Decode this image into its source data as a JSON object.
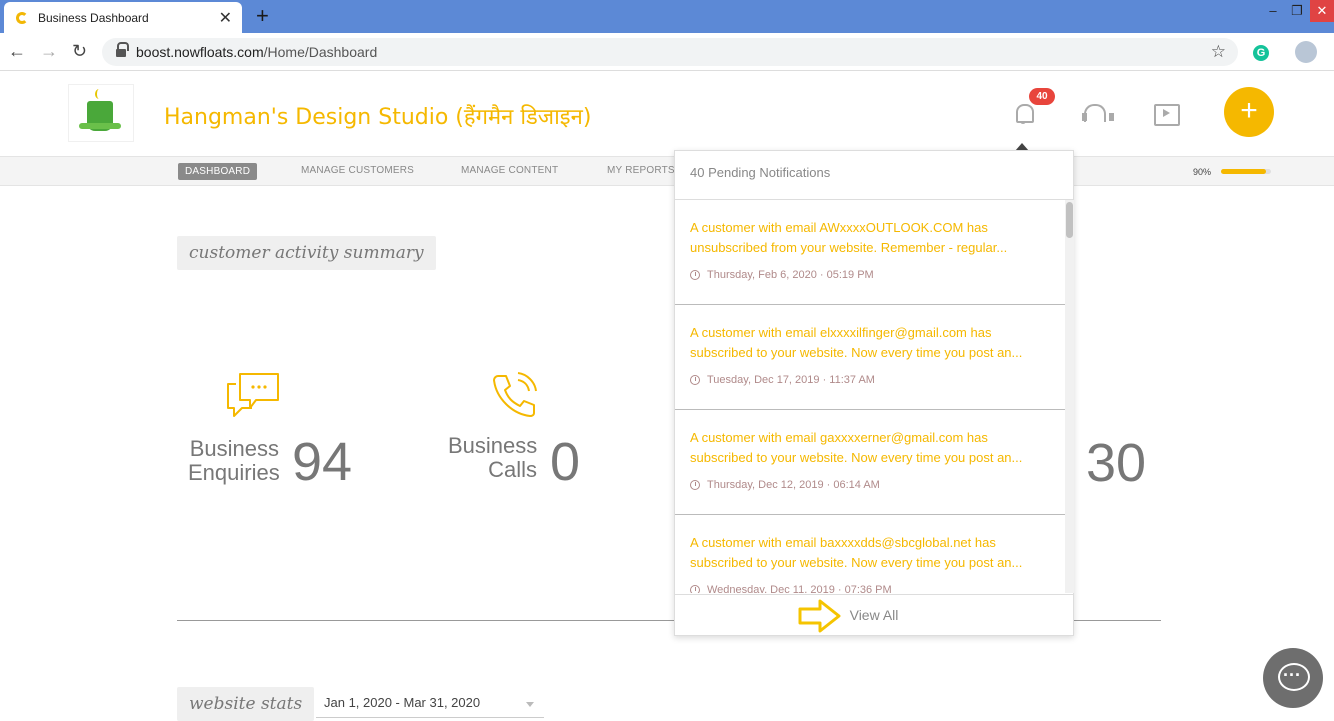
{
  "browser": {
    "tab_title": "Business Dashboard",
    "url_domain": "boost.nowfloats.com",
    "url_path": "/Home/Dashboard"
  },
  "header": {
    "business_name": "Hangman's Design Studio (हैंगमैन डिजाइन)",
    "notification_count": "40",
    "add_label": "+"
  },
  "subnav": {
    "items": [
      "DASHBOARD",
      "MANAGE CUSTOMERS",
      "MANAGE CONTENT",
      "MY REPORTS"
    ],
    "active": "DASHBOARD",
    "profile_completion_label": "90%",
    "profile_completion": 0.9
  },
  "activity": {
    "title": "customer activity summary",
    "stats": [
      {
        "label_line1": "Business",
        "label_line2": "Enquiries",
        "value": "94",
        "icon": "chat-bubbles-icon"
      },
      {
        "label_line1": "Business",
        "label_line2": "Calls",
        "value": "0",
        "icon": "phone-icon"
      },
      {
        "value": "30"
      }
    ]
  },
  "website_stats": {
    "title": "website stats",
    "date_range": "Jan 1, 2020 - Mar 31, 2020"
  },
  "notifications": {
    "header": "40 Pending Notifications",
    "items": [
      {
        "text": "A customer with email AWxxxxOUTLOOK.COM has unsubscribed from your website. Remember - regular...",
        "time": "Thursday, Feb 6, 2020 · 05:19 PM"
      },
      {
        "text": "A customer with email elxxxxilfinger@gmail.com has subscribed to your website. Now every time you post an...",
        "time": "Tuesday, Dec 17, 2019 · 11:37 AM"
      },
      {
        "text": "A customer with email gaxxxxerner@gmail.com has subscribed to your website. Now every time you post an...",
        "time": "Thursday, Dec 12, 2019 · 06:14 AM"
      },
      {
        "text": "A customer with email baxxxxdds@sbcglobal.net has subscribed to your website. Now every time you post an...",
        "time": "Wednesday, Dec 11, 2019 · 07:36 PM"
      }
    ],
    "view_all": "View All"
  },
  "colors": {
    "accent": "#f5b800",
    "browser_frame": "#5c89d6",
    "badge": "#e8453c"
  }
}
